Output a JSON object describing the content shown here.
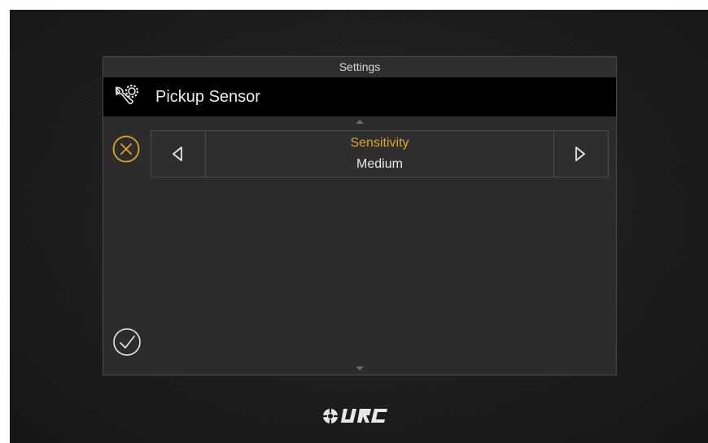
{
  "dialog": {
    "title": "Settings",
    "header": {
      "title": "Pickup Sensor",
      "icon": "wrench-gear-icon"
    },
    "selector": {
      "label": "Sensitivity",
      "value": "Medium",
      "prev_icon": "chevron-left-icon",
      "next_icon": "chevron-right-icon"
    },
    "cancel_icon": "cancel-x-circle-icon",
    "confirm_icon": "checkmark-circle-icon"
  },
  "brand": {
    "logo_text": "URC",
    "logo_icon": "urc-logo"
  },
  "colors": {
    "accent": "#e0a526",
    "header_bg": "#000000",
    "panel_bg": "#2c2c2c",
    "text": "#e8e8e8"
  }
}
